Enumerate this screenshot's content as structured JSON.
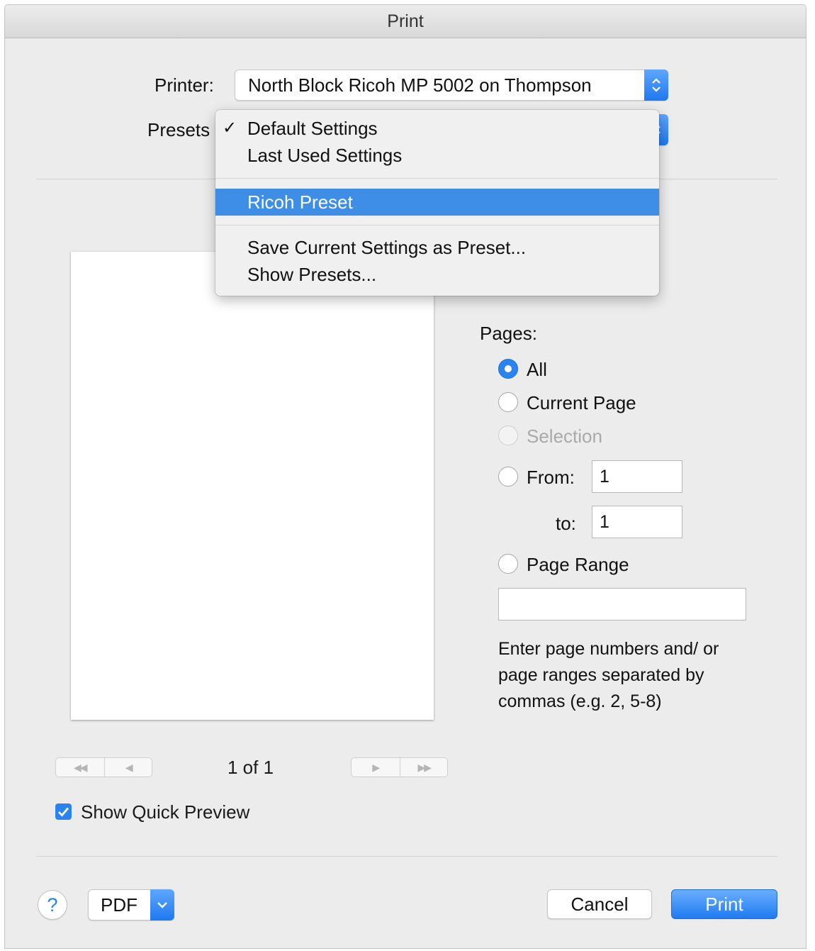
{
  "window": {
    "title": "Print"
  },
  "printer": {
    "label": "Printer:",
    "value": "North Block Ricoh MP 5002 on Thompson"
  },
  "presets": {
    "label": "Presets",
    "menu": {
      "check_mark": "✓",
      "items": [
        "Default Settings",
        "Last Used Settings",
        "Ricoh Preset",
        "Save Current Settings as Preset...",
        "Show Presets..."
      ],
      "checked": "Default Settings",
      "highlighted": "Ricoh Preset"
    }
  },
  "pages": {
    "label": "Pages:",
    "all": "All",
    "current_page": "Current Page",
    "selection": "Selection",
    "from_label": "From:",
    "from_value": "1",
    "to_label": "to:",
    "to_value": "1",
    "page_range": "Page Range",
    "page_range_value": "",
    "help": "Enter page numbers and/ or page ranges separated by commas (e.g. 2, 5-8)",
    "selected": "All"
  },
  "preview": {
    "page_indicator": "1 of 1",
    "show_quick_preview_label": "Show Quick Preview",
    "show_quick_preview_checked": true
  },
  "footer": {
    "help": "?",
    "pdf": "PDF",
    "cancel": "Cancel",
    "print": "Print"
  },
  "colors": {
    "accent": "#2a83ef",
    "menu_highlight": "#3e8ee8"
  }
}
